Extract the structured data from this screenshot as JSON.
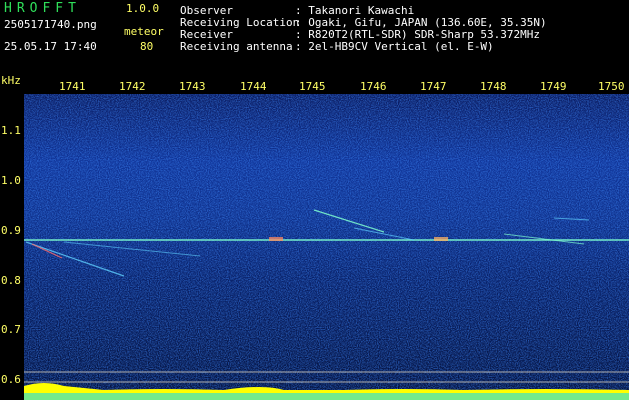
{
  "app": {
    "name": "HROFFT",
    "version": "1.0.0"
  },
  "file": {
    "name": "2505171740.png",
    "datetime": "25.05.17 17:40"
  },
  "mode": {
    "label": "meteor",
    "value": "80"
  },
  "info": {
    "observer": {
      "label": "Observer",
      "value": "Takanori Kawachi"
    },
    "location": {
      "label": "Receiving Location",
      "value": "Ogaki, Gifu, JAPAN (136.60E, 35.35N)"
    },
    "receiver": {
      "label": "Receiver",
      "value": "R820T2(RTL-SDR) SDR-Sharp 53.372MHz"
    },
    "antenna": {
      "label": "Receiving antenna",
      "value": "2el-HB9CV Vertical (el. E-W)"
    }
  },
  "time_axis": {
    "ticks": [
      "1741",
      "1742",
      "1743",
      "1744",
      "1745",
      "1746",
      "1747",
      "1748",
      "1749",
      "1750"
    ]
  },
  "freq_axis": {
    "unit": "kHz",
    "ticks": [
      "1.1",
      "1.0",
      "0.9",
      "0.8",
      "0.7",
      "0.6"
    ]
  },
  "colors": {
    "title": "#2fe05a",
    "label": "#ffff66",
    "background": "#04103a",
    "carrier": "#7fffd0"
  }
}
